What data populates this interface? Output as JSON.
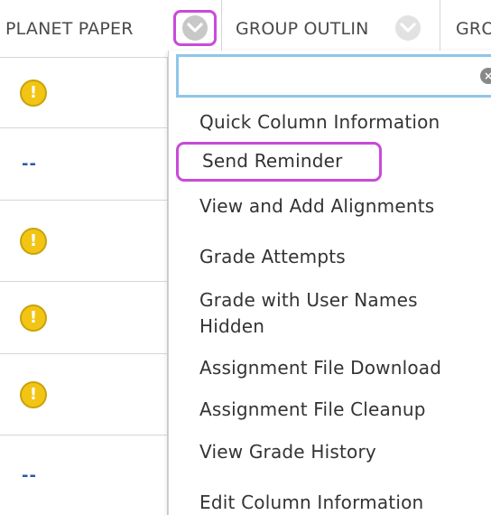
{
  "header": {
    "columns": [
      {
        "label": "PLANET PAPER"
      },
      {
        "label": "GROUP OUTLIN"
      },
      {
        "label": "GRO"
      }
    ]
  },
  "rows": [
    {
      "type": "warning",
      "value": "!"
    },
    {
      "type": "dash",
      "value": "--"
    },
    {
      "type": "warning",
      "value": "!"
    },
    {
      "type": "warning",
      "value": "!"
    },
    {
      "type": "warning",
      "value": "!"
    },
    {
      "type": "dash",
      "value": "--"
    }
  ],
  "menu": {
    "search": {
      "value": "",
      "placeholder": ""
    },
    "items": [
      {
        "label": "Quick Column Information"
      },
      {
        "label": "Send Reminder"
      },
      {
        "label": "View and Add Alignments"
      },
      {
        "label": "Grade Attempts"
      },
      {
        "label": "Grade with User Names"
      },
      {
        "label": "Hidden"
      },
      {
        "label": "Assignment File Download"
      },
      {
        "label": "Assignment File Cleanup"
      },
      {
        "label": "View Grade History"
      },
      {
        "label": "Edit Column Information"
      }
    ]
  },
  "colors": {
    "highlight": "#c94ad8",
    "search_border": "#8fc6ea",
    "warning": "#f2c515",
    "link": "#2a5aa8"
  },
  "icons": {
    "column_menu": "chevron-down-icon",
    "warning": "exclamation-circle-icon",
    "clear": "clear-x-icon"
  }
}
